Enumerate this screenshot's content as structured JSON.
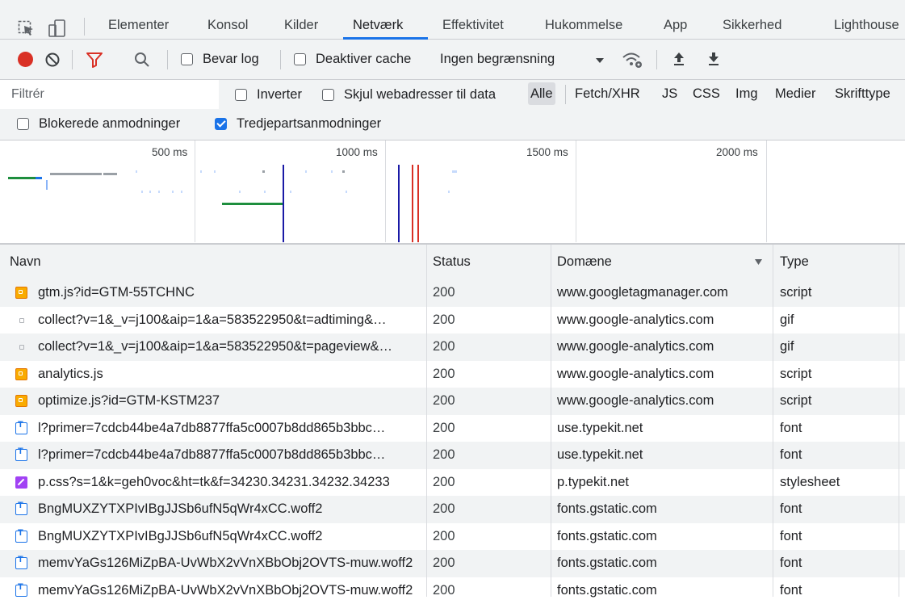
{
  "tabs": [
    "Elementer",
    "Konsol",
    "Kilder",
    "Netværk",
    "Effektivitet",
    "Hukommelse",
    "App",
    "Sikkerhed",
    "Lighthouse"
  ],
  "active_tab": "Netværk",
  "toolbar": {
    "preserve_log": "Bevar log",
    "disable_cache": "Deaktiver cache",
    "throttling": "Ingen begrænsning"
  },
  "filter": {
    "placeholder": "Filtrér",
    "invert": "Inverter",
    "hide_data_urls": "Skjul webadresser til data",
    "types": [
      "Alle",
      "Fetch/XHR",
      "JS",
      "CSS",
      "Img",
      "Medier",
      "Skrifttype"
    ]
  },
  "blocked_requests": "Blokerede anmodninger",
  "third_party": "Tredjepartsanmodninger",
  "overview": {
    "ticks": [
      "500 ms",
      "1000 ms",
      "1500 ms",
      "2000 ms"
    ]
  },
  "columns": {
    "name": "Navn",
    "status": "Status",
    "domain": "Domæne",
    "type": "Type"
  },
  "requests": [
    {
      "name": "gtm.js?id=GTM-55TCHNC",
      "status": "200",
      "domain": "www.googletagmanager.com",
      "type": "script"
    },
    {
      "name": "collect?v=1&_v=j100&aip=1&a=583522950&t=adtiming&…",
      "status": "200",
      "domain": "www.google-analytics.com",
      "type": "gif"
    },
    {
      "name": "collect?v=1&_v=j100&aip=1&a=583522950&t=pageview&…",
      "status": "200",
      "domain": "www.google-analytics.com",
      "type": "gif"
    },
    {
      "name": "analytics.js",
      "status": "200",
      "domain": "www.google-analytics.com",
      "type": "script"
    },
    {
      "name": "optimize.js?id=GTM-KSTM237",
      "status": "200",
      "domain": "www.google-analytics.com",
      "type": "script"
    },
    {
      "name": "l?primer=7cdcb44be4a7db8877ffa5c0007b8dd865b3bbc…",
      "status": "200",
      "domain": "use.typekit.net",
      "type": "font"
    },
    {
      "name": "l?primer=7cdcb44be4a7db8877ffa5c0007b8dd865b3bbc…",
      "status": "200",
      "domain": "use.typekit.net",
      "type": "font"
    },
    {
      "name": "p.css?s=1&k=geh0voc&ht=tk&f=34230.34231.34232.34233",
      "status": "200",
      "domain": "p.typekit.net",
      "type": "stylesheet"
    },
    {
      "name": "BngMUXZYTXPIvIBgJJSb6ufN5qWr4xCC.woff2",
      "status": "200",
      "domain": "fonts.gstatic.com",
      "type": "font"
    },
    {
      "name": "BngMUXZYTXPIvIBgJJSb6ufN5qWr4xCC.woff2",
      "status": "200",
      "domain": "fonts.gstatic.com",
      "type": "font"
    },
    {
      "name": "memvYaGs126MiZpBA-UvWbX2vVnXBbObj2OVTS-muw.woff2",
      "status": "200",
      "domain": "fonts.gstatic.com",
      "type": "font"
    },
    {
      "name": "memvYaGs126MiZpBA-UvWbX2vVnXBbObj2OVTS-muw.woff2",
      "status": "200",
      "domain": "fonts.gstatic.com",
      "type": "font"
    }
  ]
}
